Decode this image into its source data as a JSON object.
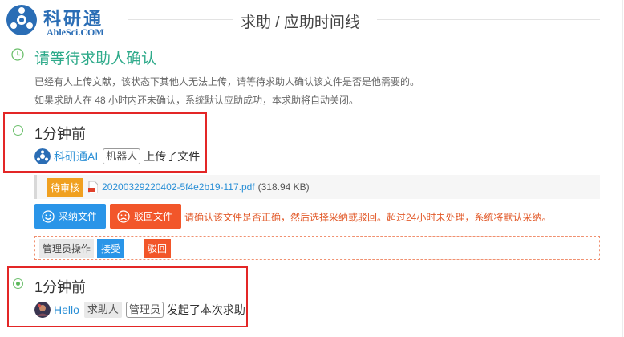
{
  "logo": {
    "cn": "科研通",
    "en": "AbleSci.COM"
  },
  "page_title": "求助 / 应助时间线",
  "pending": {
    "title": "请等待求助人确认",
    "notice_line1": "已经有人上传文献，该状态下其他人无法上传，请等待求助人确认该文件是否是他需要的。",
    "notice_line2": "如果求助人在 48 小时内还未确认，系统默认应助成功，本求助将自动关闭。"
  },
  "upload_event": {
    "time": "1分钟前",
    "user": "科研通AI",
    "role_tag": "机器人",
    "action": "上传了文件"
  },
  "file": {
    "status_badge": "待审核",
    "name": "20200329220402-5f4e2b19-117.pdf",
    "size": "(318.94 KB)"
  },
  "actions": {
    "accept_label": "采纳文件",
    "reject_label": "驳回文件",
    "instruction": "请确认该文件是否正确，然后选择采纳或驳回。超过24小时未处理，系统将默认采纳。"
  },
  "admin": {
    "label": "管理员操作",
    "accept": "接受",
    "reject": "驳回"
  },
  "request_event": {
    "time": "1分钟前",
    "user": "Hello",
    "tag1": "求助人",
    "tag2": "管理员",
    "action": "发起了本次求助"
  },
  "colors": {
    "brand_blue": "#2a6db5",
    "pending_green": "#2eaa8a",
    "link_blue": "#2a8fd6",
    "accept_blue": "#2a95e8",
    "reject_orange": "#f2562a",
    "review_orange": "#f0a020",
    "highlight_red": "#e32626"
  }
}
